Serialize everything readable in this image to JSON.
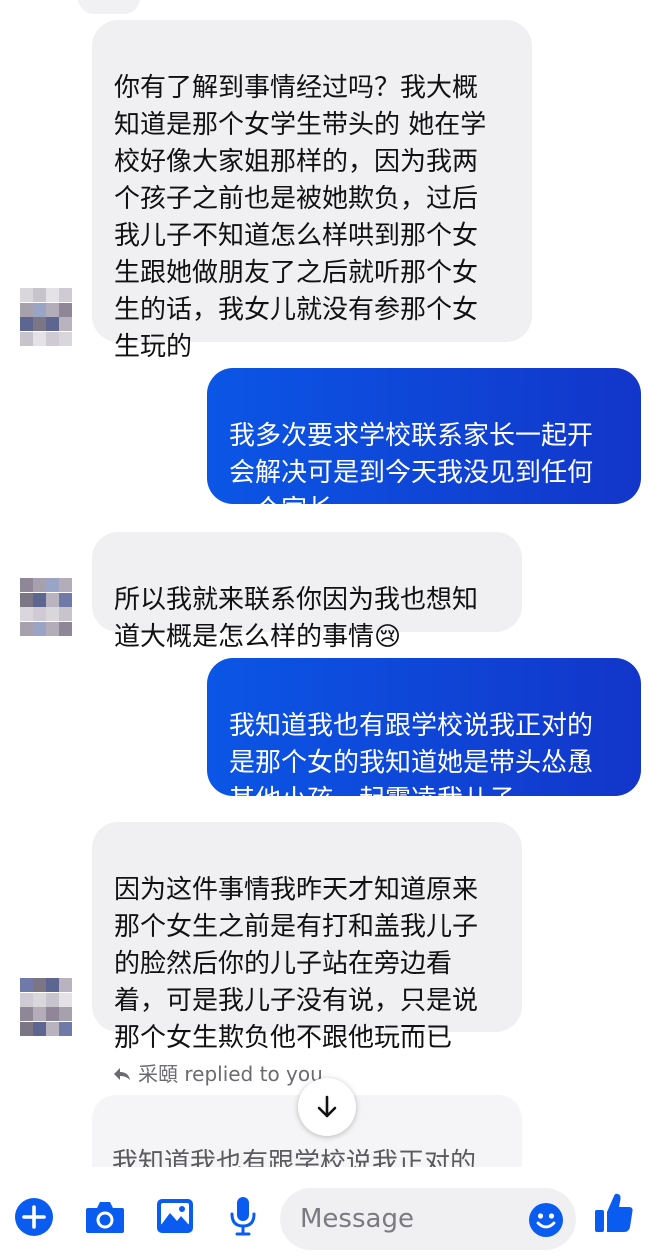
{
  "messages": [
    {
      "side": "in",
      "text": "你有了解到事情经过吗？我大概\n知道是那个女学生带头的 她在学\n校好像大家姐那样的，因为我两\n个孩子之前也是被她欺负，过后\n我儿子不知道怎么样哄到那个女\n生跟她做朋友了之后就听那个女\n生的话，我女儿就没有参那个女\n生玩的"
    },
    {
      "side": "out",
      "text": "我多次要求学校联系家长一起开\n会解决可是到今天我没见到任何\n一个家长"
    },
    {
      "side": "in",
      "text": "所以我就来联系你因为我也想知\n道大概是怎么样的事情",
      "emoji": "😢"
    },
    {
      "side": "out",
      "text": "我知道我也有跟学校说我正对的\n是那个女的我知道她是带头怂恿\n其他小孩一起霸凌我儿子"
    },
    {
      "side": "in",
      "text": "因为这件事情我昨天才知道原来\n那个女生之前是有打和盖我儿子\n的脸然后你的儿子站在旁边看\n着，可是我儿子没有说，只是说\n那个女生欺负他不跟他玩而已"
    }
  ],
  "reply": {
    "header": "采頤 replied to you",
    "preview": "我知道我也有跟学校说我正对的\n是那个女的我知道她是带头怂恿"
  },
  "composer": {
    "placeholder": "Message"
  },
  "icons": {
    "add": "plus-circle-icon",
    "camera": "camera-icon",
    "gallery": "image-icon",
    "voice": "microphone-icon",
    "emoji": "smiley-icon",
    "like": "thumbs-up-icon",
    "scroll": "arrow-down-icon",
    "reply": "reply-arrow-icon"
  },
  "colors": {
    "accent": "#0a5cf0",
    "outgoing_bubble": "#1240d4",
    "incoming_bubble": "#f0f0f3"
  }
}
